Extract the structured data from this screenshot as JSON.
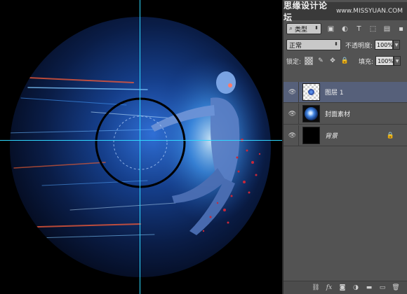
{
  "watermark": {
    "text_cn": "思缘设计论坛",
    "text_en": "www.MISSYUAN.COM"
  },
  "layers_panel": {
    "filter": {
      "label": "类型"
    },
    "blend_mode": "正常",
    "opacity": {
      "label": "不透明度:",
      "value": "100%"
    },
    "lock": {
      "label": "锁定:"
    },
    "fill": {
      "label": "填充:",
      "value": "100%"
    },
    "layers": [
      {
        "name": "图层 1",
        "selected": true,
        "visible": true
      },
      {
        "name": "封面素材",
        "selected": false,
        "visible": true
      },
      {
        "name": "背景",
        "selected": false,
        "visible": true,
        "locked": true
      }
    ]
  },
  "icons": {
    "filter_buttons": [
      "image-filter-icon",
      "adjustment-filter-icon",
      "type-filter-icon",
      "shape-filter-icon",
      "smart-object-filter-icon",
      "toggle-filter-icon"
    ],
    "lock_buttons": [
      "lock-transparent-icon",
      "lock-paint-icon",
      "lock-move-icon",
      "lock-all-icon"
    ],
    "bottom_buttons": [
      "link-layers-icon",
      "fx-icon",
      "add-mask-icon",
      "new-adjustment-icon",
      "new-group-icon",
      "new-layer-icon",
      "delete-layer-icon"
    ]
  },
  "colors": {
    "guide": "#2fd8ff",
    "panel_bg": "#535353",
    "selected_layer": "#56607a"
  }
}
